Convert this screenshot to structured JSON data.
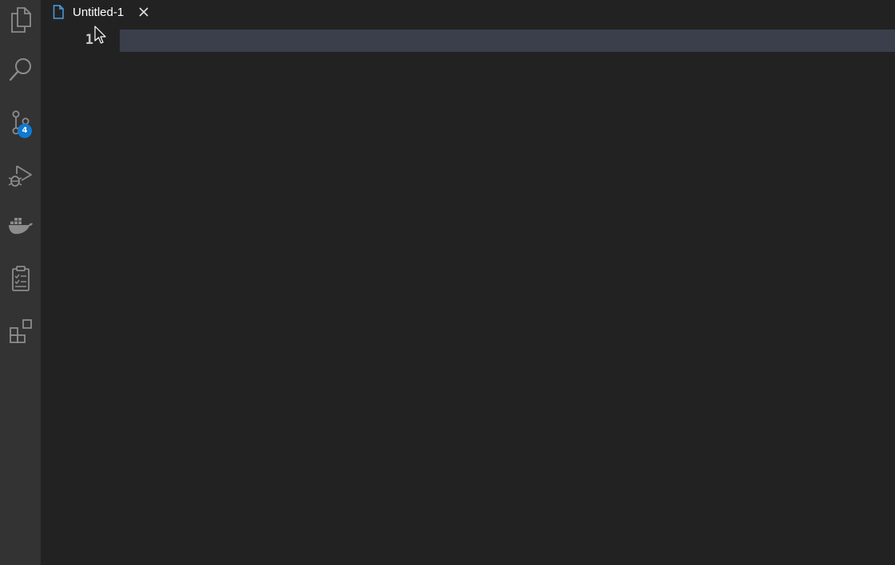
{
  "activity_bar": {
    "items": [
      {
        "name": "explorer",
        "icon": "files-icon"
      },
      {
        "name": "search",
        "icon": "search-icon"
      },
      {
        "name": "source-control",
        "icon": "source-control-icon",
        "badge": "4"
      },
      {
        "name": "run-debug",
        "icon": "run-debug-icon"
      },
      {
        "name": "docker",
        "icon": "docker-icon"
      },
      {
        "name": "tasks",
        "icon": "clipboard-checklist-icon"
      },
      {
        "name": "extensions",
        "icon": "extensions-icon"
      }
    ]
  },
  "tabs": [
    {
      "label": "Untitled-1",
      "icon": "file-icon",
      "close_icon": "close-icon"
    }
  ],
  "editor": {
    "line_numbers": [
      "1"
    ],
    "lines": [
      ""
    ]
  },
  "colors": {
    "activity_bar_bg": "#333333",
    "editor_bg": "#222222",
    "line_highlight": "#3a3f4b",
    "badge_bg": "#0e7ad3",
    "file_icon": "#4a9fe0",
    "icon": "#8c8c8c"
  }
}
